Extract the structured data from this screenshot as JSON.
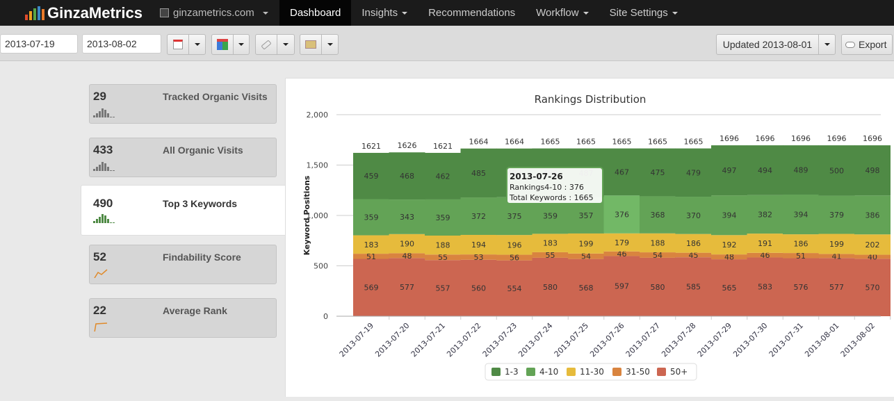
{
  "nav": {
    "brand": "GinzaMetrics",
    "site": "ginzametrics.com",
    "items": [
      {
        "label": "Dashboard",
        "active": true,
        "caret": false
      },
      {
        "label": "Insights",
        "caret": true
      },
      {
        "label": "Recommendations",
        "caret": false
      },
      {
        "label": "Workflow",
        "caret": true
      },
      {
        "label": "Site Settings",
        "caret": true
      }
    ]
  },
  "toolbar": {
    "start_date": "2013-07-19",
    "end_date": "2013-08-02",
    "icons": [
      "calendar-icon",
      "google-icon",
      "tag-icon",
      "money-icon"
    ],
    "updated": "Updated 2013-08-01",
    "export": "Export"
  },
  "cards": [
    {
      "value": "29",
      "label": "Tracked Organic Visits",
      "spark": "bars"
    },
    {
      "value": "433",
      "label": "All Organic Visits",
      "spark": "bars"
    },
    {
      "value": "490",
      "label": "Top 3 Keywords",
      "spark": "bars",
      "selected": true
    },
    {
      "value": "52",
      "label": "Findability Score",
      "spark": "line"
    },
    {
      "value": "22",
      "label": "Average Rank",
      "spark": "line"
    }
  ],
  "chart_data": {
    "type": "bar",
    "stacked": true,
    "title": "Rankings Distribution",
    "ylabel": "Keyword Positions",
    "ylim": [
      0,
      2000
    ],
    "yticks": [
      "0",
      "500",
      "1,000",
      "1,500",
      "2,000"
    ],
    "grid": true,
    "legend_placement": "bottom",
    "categories": [
      "2013-07-19",
      "2013-07-20",
      "2013-07-21",
      "2013-07-22",
      "2013-07-23",
      "2013-07-24",
      "2013-07-25",
      "2013-07-26",
      "2013-07-27",
      "2013-07-28",
      "2013-07-29",
      "2013-07-30",
      "2013-07-31",
      "2013-08-01",
      "2013-08-02"
    ],
    "totals": [
      1621,
      1626,
      1621,
      1664,
      1664,
      1665,
      1665,
      1665,
      1665,
      1665,
      1696,
      1696,
      1696,
      1696,
      1696
    ],
    "series": [
      {
        "name": "50+",
        "color": "#cc6651",
        "values": [
          569,
          577,
          557,
          560,
          554,
          580,
          568,
          597,
          580,
          585,
          565,
          583,
          576,
          577,
          570
        ]
      },
      {
        "name": "31-50",
        "color": "#d9843f",
        "values": [
          51,
          48,
          55,
          53,
          56,
          55,
          54,
          46,
          54,
          45,
          48,
          46,
          51,
          41,
          40
        ]
      },
      {
        "name": "11-30",
        "color": "#e6bb3c",
        "values": [
          183,
          190,
          188,
          194,
          196,
          183,
          199,
          179,
          188,
          186,
          192,
          191,
          186,
          199,
          202
        ]
      },
      {
        "name": "4-10",
        "color": "#63a356",
        "values": [
          359,
          343,
          359,
          372,
          375,
          359,
          357,
          376,
          368,
          370,
          394,
          382,
          394,
          379,
          386
        ]
      },
      {
        "name": "1-3",
        "color": "#4f8a45",
        "values": [
          459,
          468,
          462,
          485,
          483,
          488,
          487,
          467,
          475,
          479,
          497,
          494,
          489,
          500,
          498
        ]
      }
    ],
    "legend_order": [
      "1-3",
      "4-10",
      "11-30",
      "31-50",
      "50+"
    ],
    "tooltip": {
      "title": "2013-07-26",
      "line1": "Rankings4-10 : 376",
      "line2": "Total Keywords : 1665"
    }
  }
}
